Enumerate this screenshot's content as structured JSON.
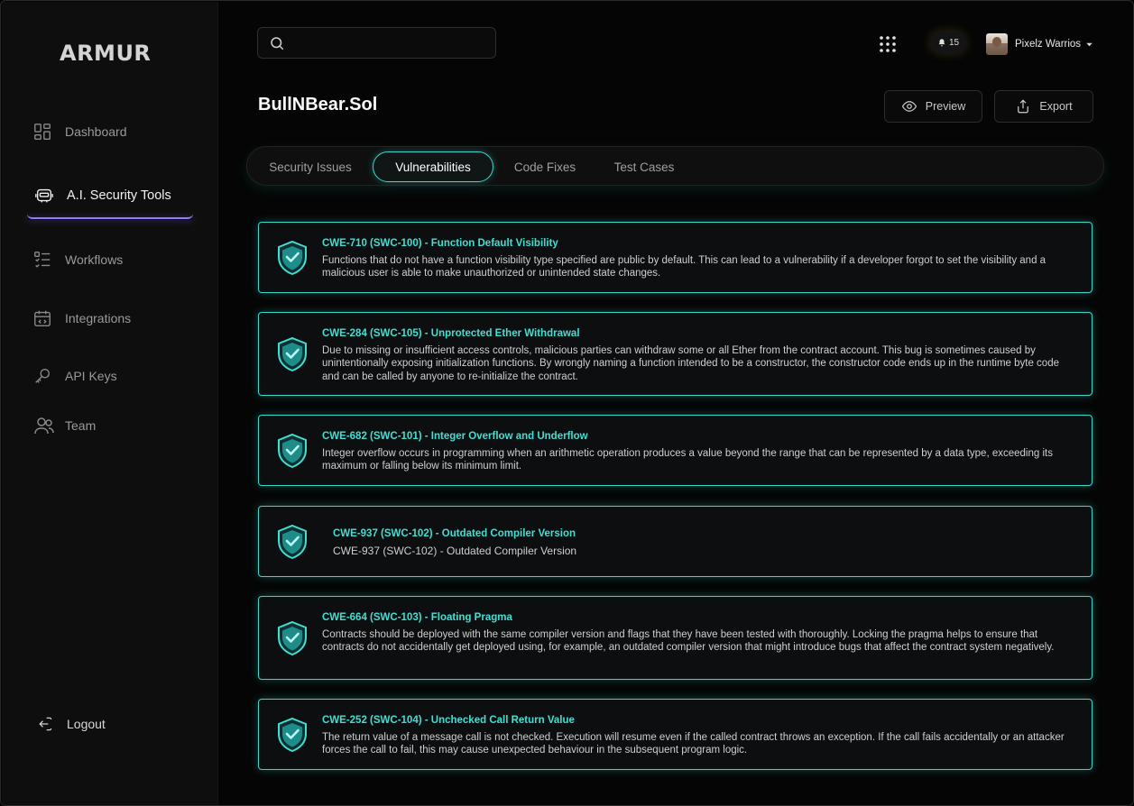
{
  "app": {
    "logo": "ARMUR"
  },
  "sidebar": {
    "items": [
      {
        "label": "Dashboard",
        "icon": "dashboard-icon"
      },
      {
        "label": "A.I. Security Tools",
        "icon": "robot-icon",
        "active": true
      },
      {
        "label": "Workflows",
        "icon": "workflow-icon"
      },
      {
        "label": "Integrations",
        "icon": "integrations-icon"
      },
      {
        "label": "API Keys",
        "icon": "key-icon"
      },
      {
        "label": "Team",
        "icon": "team-icon"
      }
    ],
    "logout": "Logout"
  },
  "header": {
    "search_placeholder": "",
    "notifications_count": "15",
    "user_name": "Pixelz Warrios"
  },
  "page": {
    "title": "BullNBear.Sol",
    "preview_label": "Preview",
    "export_label": "Export"
  },
  "tabs": [
    {
      "label": "Security Issues"
    },
    {
      "label": "Vulnerabilities",
      "active": true
    },
    {
      "label": "Code Fixes"
    },
    {
      "label": "Test Cases"
    }
  ],
  "vulnerabilities": [
    {
      "title": "CWE-710 (SWC-100) - Function Default Visibility",
      "description": "Functions that do not have a function visibility type specified are public by default. This can lead to a vulnerability if a developer forgot to set the visibility and a malicious user is able to make unauthorized or unintended state changes."
    },
    {
      "title": "CWE-284 (SWC-105) - Unprotected Ether Withdrawal",
      "description": "Due to missing or insufficient access controls, malicious parties can withdraw some or all Ether from the contract account. This bug is sometimes caused by unintentionally exposing initialization functions. By wrongly naming a function intended to be a constructor, the constructor code ends up in the runtime byte code and can be called by anyone to re-initialize the contract."
    },
    {
      "title": "CWE-682 (SWC-101) - Integer Overflow and Underflow",
      "description": "Integer overflow occurs in programming when an arithmetic operation produces a value beyond the range that can be represented by a data type, exceeding its maximum or falling below its minimum limit."
    },
    {
      "title": "CWE-937 (SWC-102) - Outdated Compiler Version",
      "description": "CWE-937 (SWC-102) - Outdated Compiler Version"
    },
    {
      "title": "CWE-664 (SWC-103) - Floating Pragma",
      "description": "Contracts should be deployed with the same compiler version and flags that they have been tested with thoroughly. Locking the pragma helps to ensure that contracts do not accidentally get deployed using, for example, an outdated compiler version that might introduce bugs that affect the contract system negatively."
    },
    {
      "title": "CWE-252 (SWC-104) - Unchecked Call Return Value",
      "description": "The return value of a message call is not checked. Execution will resume even if the called contract throws an exception. If the call fails accidentally or an attacker forces the call to fail, this may cause unexpected behaviour in the subsequent program logic."
    }
  ],
  "colors": {
    "accent": "#38d7cc",
    "active_nav_underline": "#8f7cff",
    "background": "#050505"
  }
}
